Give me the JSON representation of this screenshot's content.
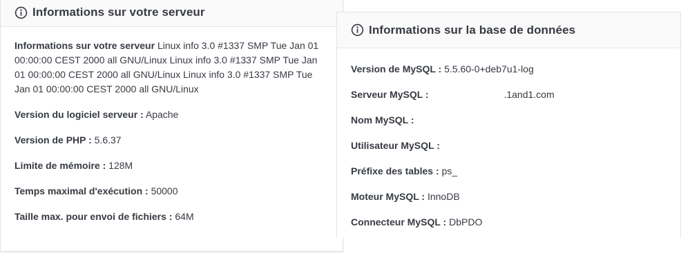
{
  "server_panel": {
    "title": "Informations sur votre serveur",
    "icon": "info-circle-icon",
    "rows": [
      {
        "label": "Informations sur votre serveur",
        "value": "Linux info 3.0 #1337 SMP Tue Jan 01 00:00:00 CEST 2000 all GNU/Linux Linux info 3.0 #1337 SMP Tue Jan 01 00:00:00 CEST 2000 all GNU/Linux Linux info 3.0 #1337 SMP Tue Jan 01 00:00:00 CEST 2000 all GNU/Linux"
      },
      {
        "label": "Version du logiciel serveur :",
        "value": "Apache"
      },
      {
        "label": "Version de PHP :",
        "value": "5.6.37"
      },
      {
        "label": "Limite de mémoire :",
        "value": "128M"
      },
      {
        "label": "Temps maximal d'exécution :",
        "value": "50000"
      },
      {
        "label": "Taille max. pour envoi de fichiers :",
        "value": "64M"
      }
    ]
  },
  "db_panel": {
    "title": "Informations sur la base de données",
    "icon": "info-circle-icon",
    "rows": [
      {
        "label": "Version de MySQL :",
        "value": "5.5.60-0+deb7u1-log"
      },
      {
        "label": "Serveur MySQL :",
        "value": ".1and1.com"
      },
      {
        "label": "Nom MySQL :",
        "value": ""
      },
      {
        "label": "Utilisateur MySQL :",
        "value": ""
      },
      {
        "label": "Préfixe des tables :",
        "value": "ps_"
      },
      {
        "label": "Moteur MySQL :",
        "value": "InnoDB"
      },
      {
        "label": "Connecteur MySQL :",
        "value": "DbPDO"
      }
    ]
  }
}
